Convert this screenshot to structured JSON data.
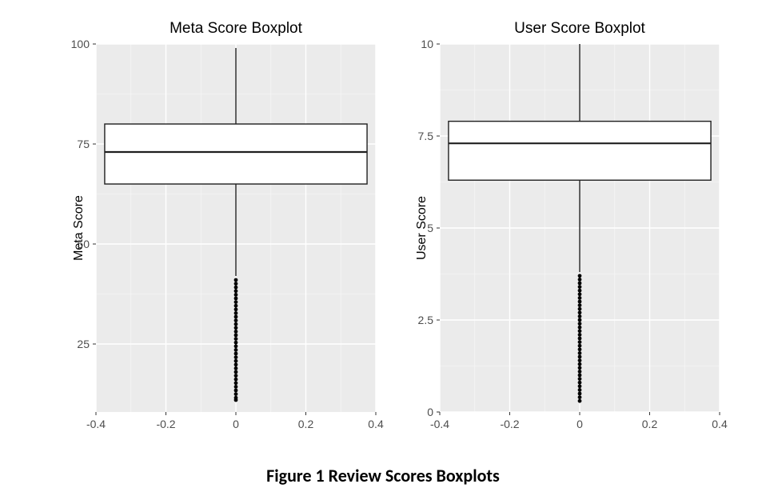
{
  "caption": "Figure 1 Review Scores Boxplots",
  "chart_data": [
    {
      "type": "boxplot",
      "title": "Meta Score Boxplot",
      "ylabel": "Meta Score",
      "xlabel": "",
      "ylim": [
        8,
        100
      ],
      "y_ticks": [
        25,
        50,
        75,
        100
      ],
      "xlim": [
        -0.4,
        0.4
      ],
      "x_ticks": [
        -0.4,
        -0.2,
        0.0,
        0.2,
        0.4
      ],
      "box": {
        "q1": 65,
        "median": 73,
        "q3": 80,
        "whisker_low": 42,
        "whisker_high": 99,
        "x": 0.0,
        "width": 0.75,
        "outlier_range": [
          11,
          41
        ]
      }
    },
    {
      "type": "boxplot",
      "title": "User Score Boxplot",
      "ylabel": "User Score",
      "xlabel": "",
      "ylim": [
        0.0,
        10.0
      ],
      "y_ticks": [
        0.0,
        2.5,
        5.0,
        7.5,
        10.0
      ],
      "xlim": [
        -0.4,
        0.4
      ],
      "x_ticks": [
        -0.4,
        -0.2,
        0.0,
        0.2,
        0.4
      ],
      "box": {
        "q1": 6.3,
        "median": 7.3,
        "q3": 7.9,
        "whisker_low": 3.8,
        "whisker_high": 10.0,
        "x": 0.0,
        "width": 0.75,
        "outlier_range": [
          0.3,
          3.7
        ]
      }
    }
  ]
}
